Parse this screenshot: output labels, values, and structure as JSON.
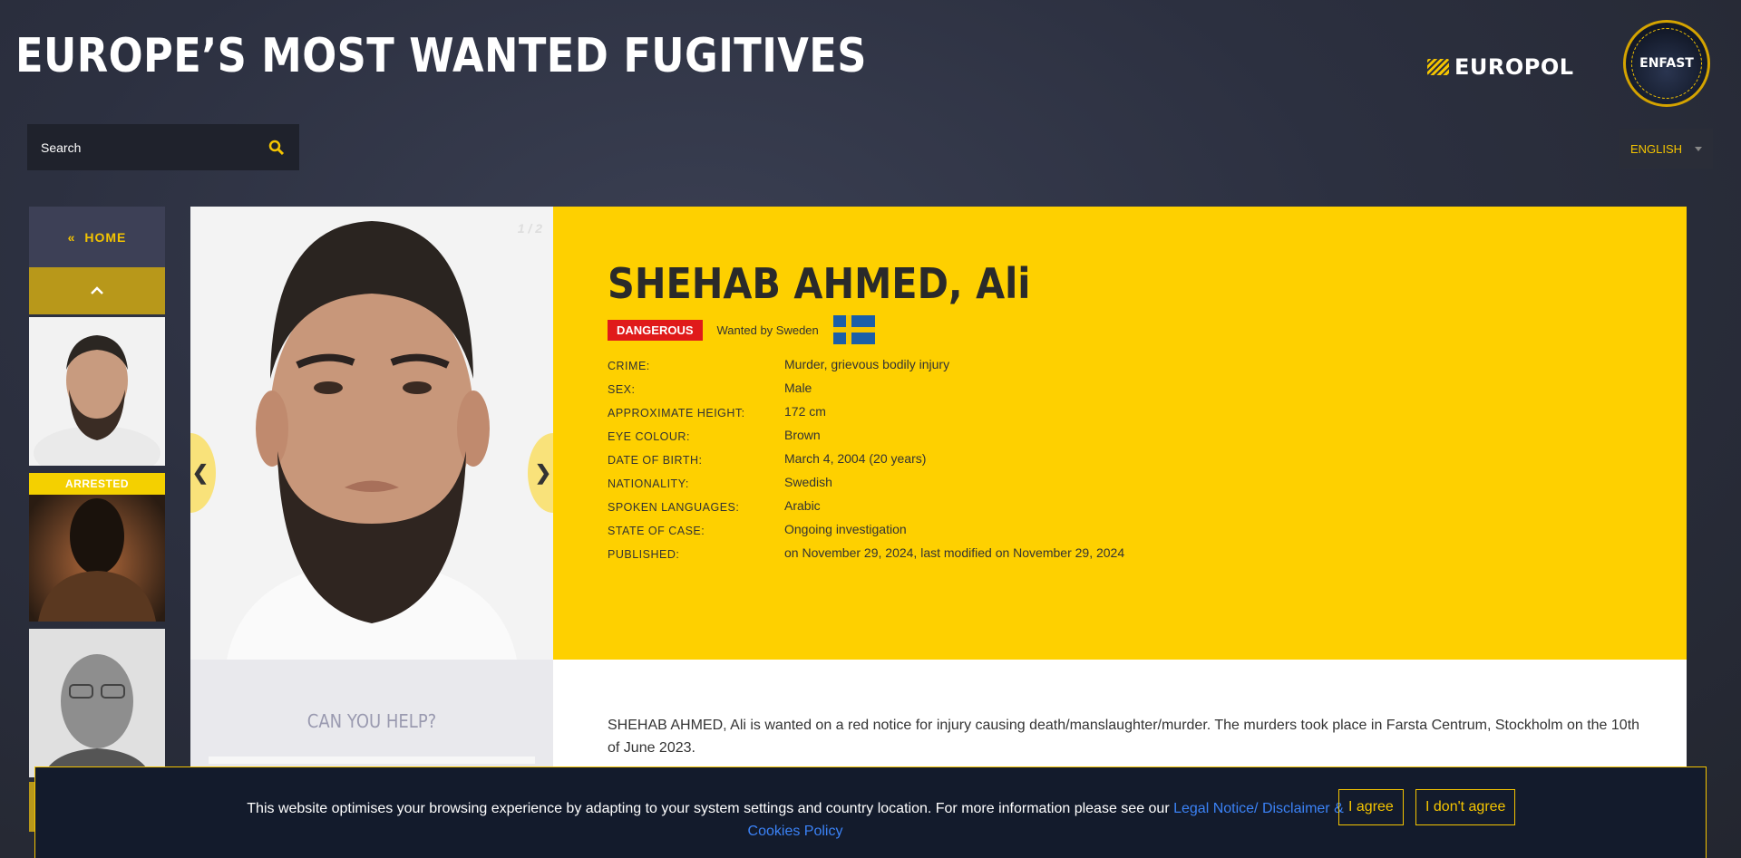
{
  "header": {
    "title": "EUROPE’S MOST WANTED FUGITIVES",
    "europol_logo_text": "EUROPOL",
    "enfast_logo_text": "ENFAST"
  },
  "search": {
    "label": "Search"
  },
  "language": {
    "selected": "ENGLISH"
  },
  "sidebar": {
    "home_label": "HOME",
    "home_icon": "«",
    "thumbnails": [
      {
        "status": ""
      },
      {
        "status": "ARRESTED"
      },
      {
        "status": ""
      }
    ]
  },
  "profile": {
    "photo_counter": "1 / 2",
    "prev_arrow": "❮",
    "next_arrow": "❯",
    "name": "SHEHAB AHMED, Ali",
    "badge": "DANGEROUS",
    "wanted_by": "Wanted by Sweden",
    "flag_icon": "sweden-flag-icon",
    "details": [
      {
        "label": "CRIME:",
        "value": "Murder, grievous bodily injury"
      },
      {
        "label": "SEX:",
        "value": "Male"
      },
      {
        "label": "APPROXIMATE HEIGHT:",
        "value": "172 cm"
      },
      {
        "label": "EYE COLOUR:",
        "value": "Brown"
      },
      {
        "label": "DATE OF BIRTH:",
        "value": "March 4, 2004 (20 years)"
      },
      {
        "label": "NATIONALITY:",
        "value": "Swedish"
      },
      {
        "label": "SPOKEN LANGUAGES:",
        "value": "Arabic"
      },
      {
        "label": "STATE OF CASE:",
        "value": "Ongoing investigation"
      },
      {
        "label": "PUBLISHED:",
        "value": "on November 29, 2024, last modified on November 29, 2024"
      }
    ],
    "help_title": "CAN YOU HELP?",
    "description": "SHEHAB AHMED, Ali is wanted on a red notice for injury causing death/manslaughter/murder. The murders took place in Farsta Centrum, Stockholm on the 10th of June 2023."
  },
  "cookie": {
    "text": "This website optimises your browsing experience by adapting to your system settings and country location. For more information please see our",
    "link_text": "Legal Notice/ Disclaimer & Cookies Policy",
    "agree": "I agree",
    "disagree": "I don't agree"
  },
  "colors": {
    "accent_yellow": "#fed000",
    "danger_red": "#e01a1a",
    "link_blue": "#3b82f6",
    "dark_bg": "#2c3040"
  }
}
